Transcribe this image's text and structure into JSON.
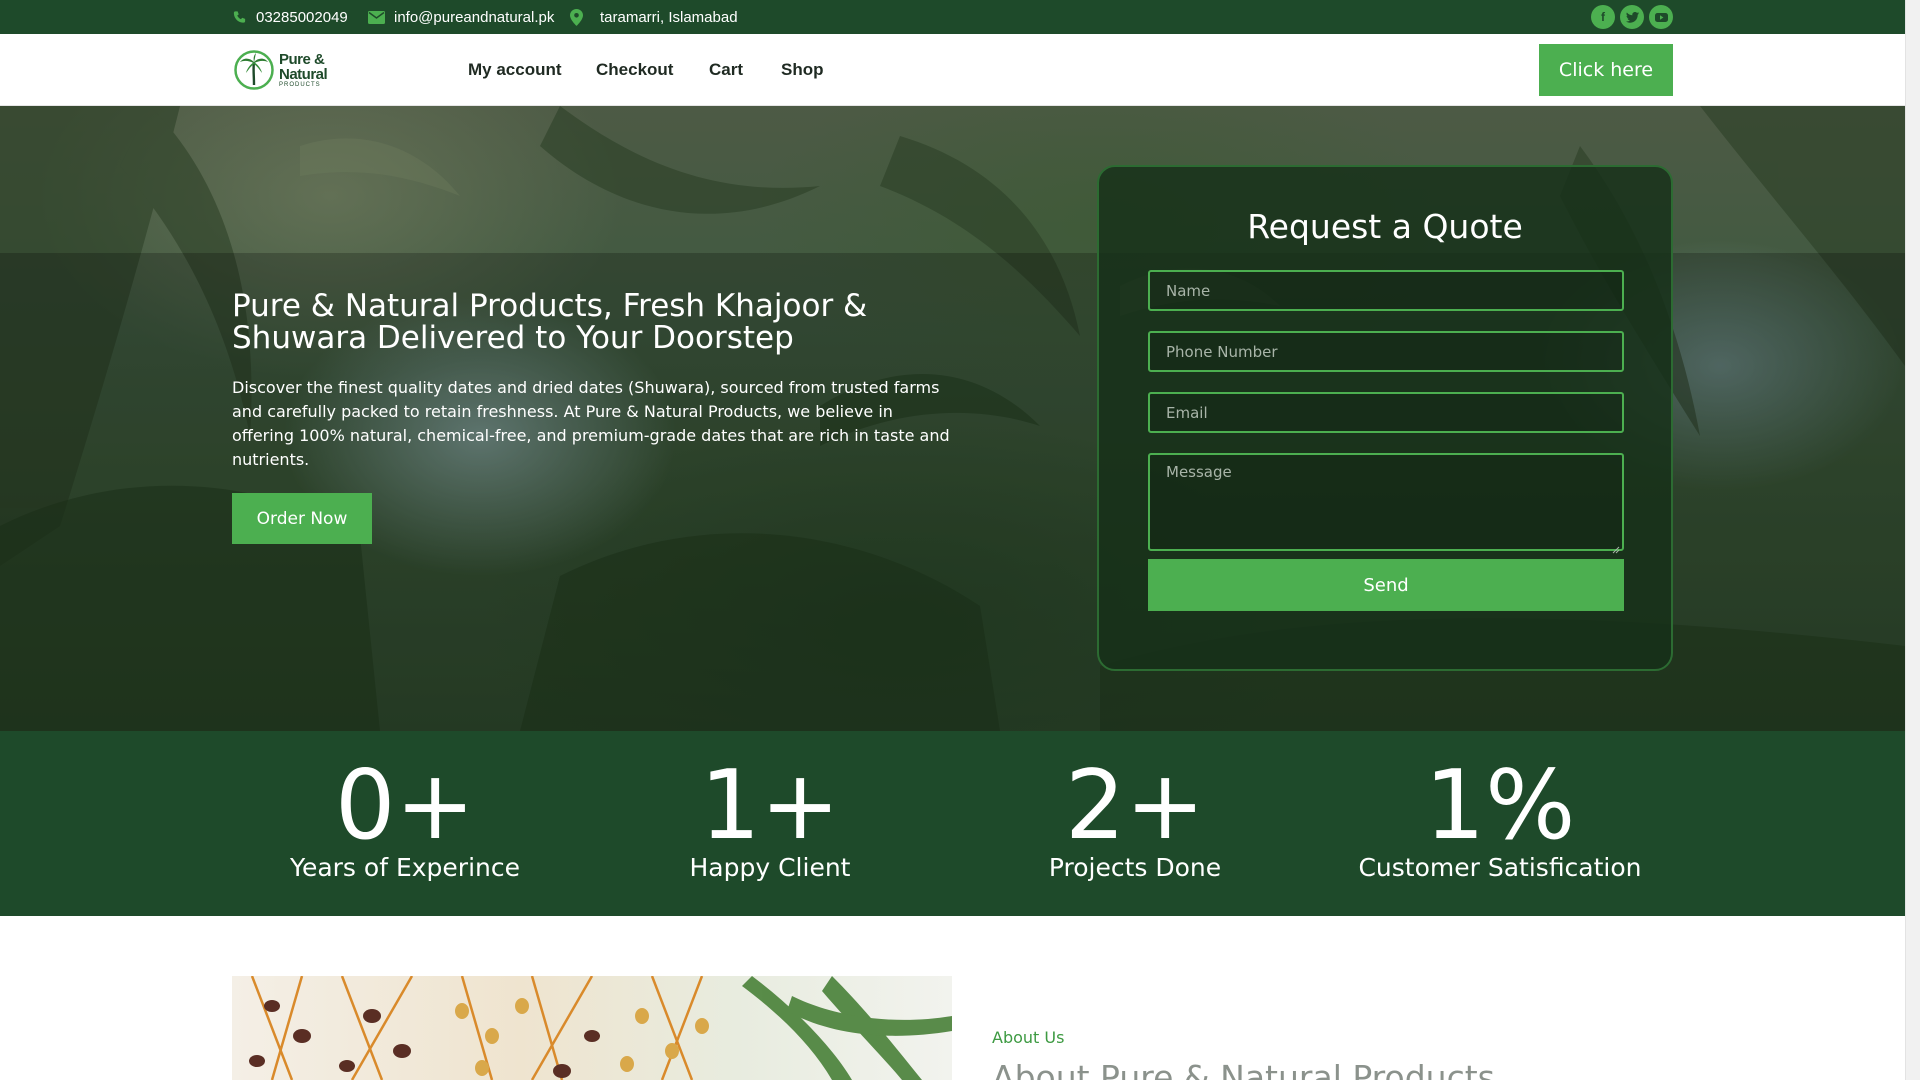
{
  "topbar": {
    "phone": "03285002049",
    "email": "info@pureandnatural.pk",
    "location": "taramarri, Islamabad",
    "social": [
      "facebook-icon",
      "twitter-icon",
      "youtube-icon"
    ]
  },
  "logo": {
    "line1": "Pure &",
    "line2": "Natural",
    "line3": "PRODUCTS"
  },
  "nav": {
    "items": [
      "My account",
      "Checkout",
      "Cart",
      "Shop"
    ],
    "cta": "Click here"
  },
  "hero": {
    "title": "Pure & Natural Products, Fresh Khajoor & Shuwara Delivered to Your Doorstep",
    "description": "Discover the finest quality dates and dried dates (Shuwara), sourced from trusted farms and carefully packed to retain freshness. At Pure & Natural Products, we believe in offering 100% natural, chemical-free, and premium-grade dates that are rich in taste and nutrients.",
    "button": "Order Now"
  },
  "quote_form": {
    "title": "Request a Quote",
    "name_placeholder": "Name",
    "phone_placeholder": "Phone Number",
    "email_placeholder": "Email",
    "message_placeholder": "Message",
    "button": "Send"
  },
  "stats": [
    {
      "value": "0+",
      "label": "Years of Experince"
    },
    {
      "value": "1+",
      "label": "Happy Client"
    },
    {
      "value": "2+",
      "label": "Projects Done"
    },
    {
      "value": "1%",
      "label": "Customer Satisfication"
    }
  ],
  "about": {
    "label": "About Us",
    "title": "About Pure & Natural Products"
  },
  "colors": {
    "brand_dark": "#1e4a2a",
    "brand_green": "#4caf50",
    "accent_text": "#3d9a42"
  }
}
